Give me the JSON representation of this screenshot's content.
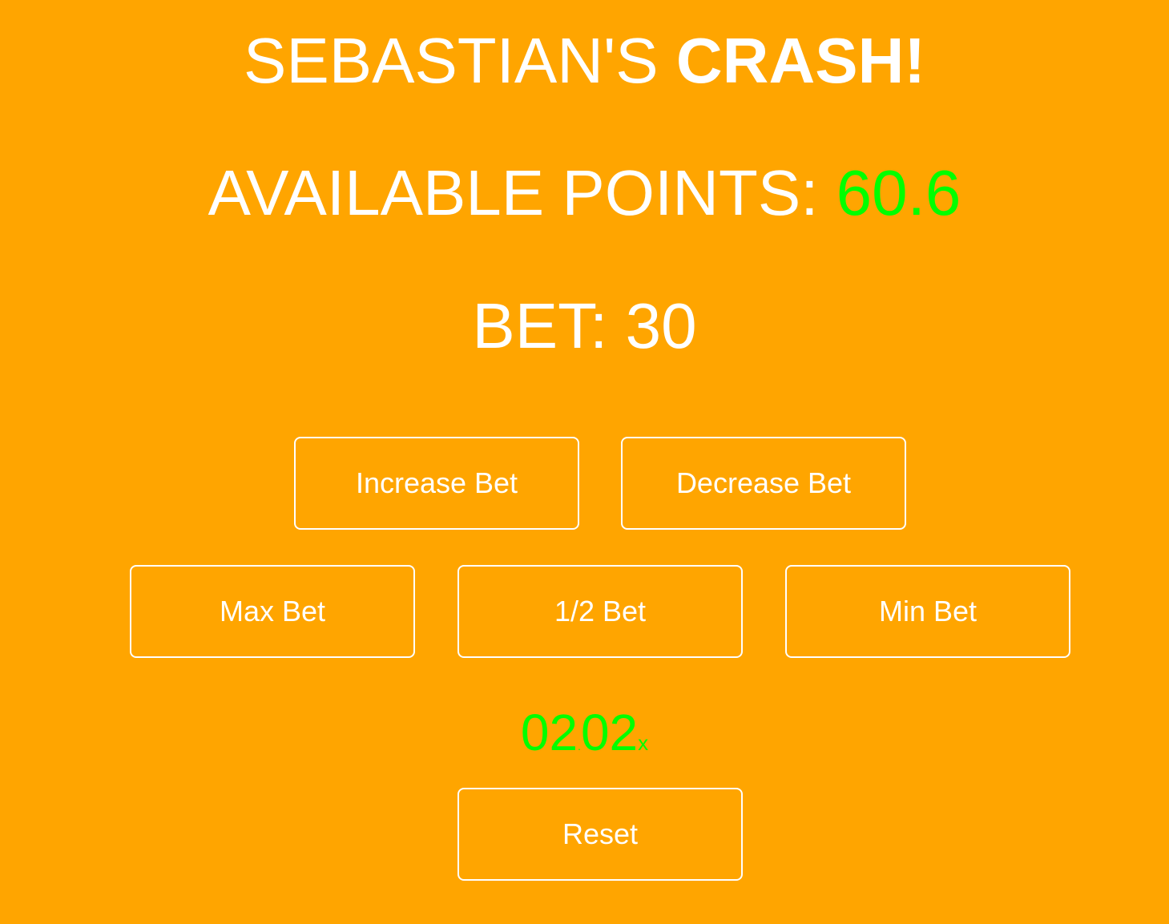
{
  "header": {
    "title_prefix": "SEBASTIAN'S ",
    "title_bold": "CRASH!"
  },
  "points": {
    "label": "AVAILABLE POINTS: ",
    "value": "60.6",
    "value_color": "#00FF00"
  },
  "bet": {
    "label": "BET: ",
    "value": "30"
  },
  "buttons": {
    "increase": "Increase Bet",
    "decrease": "Decrease Bet",
    "max": "Max Bet",
    "half": "1/2 Bet",
    "min": "Min Bet",
    "reset": "Reset"
  },
  "multiplier": {
    "whole": "02",
    "separator": ".",
    "fraction": "02",
    "suffix": "x",
    "color": "#00FF00"
  },
  "colors": {
    "background": "#FFA500",
    "text": "#FFFFFF",
    "accent": "#00FF00"
  }
}
